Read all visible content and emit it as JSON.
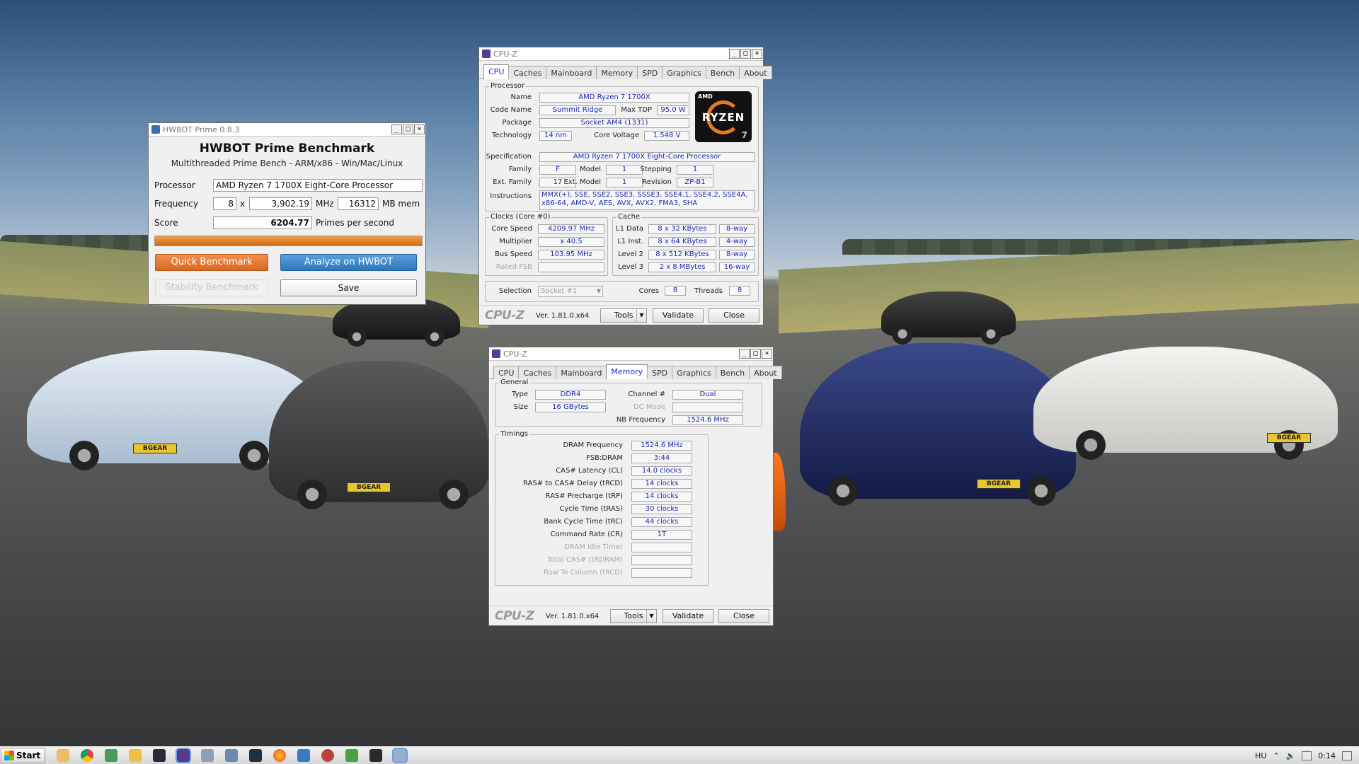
{
  "colors": {
    "cpuz_value_text": "#1c2ab0",
    "cpuz_active_tab": "#1030d0",
    "hwbot_orange": "#e07830",
    "hwbot_blue": "#3a86c8",
    "hwbot_progress": "#e07a1a"
  },
  "background": {
    "plate_text": "BGEAR"
  },
  "hwbot": {
    "title": "HWBOT Prime 0.8.3",
    "heading": "HWBOT Prime Benchmark",
    "subheading": "Multithreaded Prime Bench - ARM/x86 - Win/Mac/Linux",
    "processor_label": "Processor",
    "processor_value": "AMD Ryzen 7 1700X Eight-Core Processor",
    "frequency_label": "Frequency",
    "freq_threads": "8",
    "freq_x": "x",
    "freq_mhz": "3,902.19",
    "freq_mhz_unit": "MHz",
    "mem_value": "16312",
    "mem_unit": "MB mem",
    "score_label": "Score",
    "score_value": "6204.77",
    "score_unit": "Primes per second",
    "progress": 1.0,
    "quick_btn": "Quick Benchmark",
    "analyze_btn": "Analyze on HWBOT",
    "stability_btn": "Stability Benchmark",
    "save_btn": "Save"
  },
  "cpuz1": {
    "title": "CPU-Z",
    "tabs": [
      "CPU",
      "Caches",
      "Mainboard",
      "Memory",
      "SPD",
      "Graphics",
      "Bench",
      "About"
    ],
    "active_tab": "CPU",
    "processor_group": "Processor",
    "name_label": "Name",
    "name_value": "AMD Ryzen 7 1700X",
    "codename_label": "Code Name",
    "codename_value": "Summit Ridge",
    "maxtdp_label": "Max TDP",
    "maxtdp_value": "95.0 W",
    "package_label": "Package",
    "package_value": "Socket AM4 (1331)",
    "technology_label": "Technology",
    "technology_value": "14 nm",
    "corevoltage_label": "Core Voltage",
    "corevoltage_value": "1.548 V",
    "logo_brand": "AMD",
    "logo_text": "RYZEN",
    "logo_num": "7",
    "spec_label": "Specification",
    "spec_value": "AMD Ryzen 7 1700X Eight-Core Processor",
    "family_label": "Family",
    "family_value": "F",
    "model_label": "Model",
    "model_value": "1",
    "stepping_label": "Stepping",
    "stepping_value": "1",
    "extfamily_label": "Ext. Family",
    "extfamily_value": "17",
    "extmodel_label": "Ext. Model",
    "extmodel_value": "1",
    "revision_label": "Revision",
    "revision_value": "ZP-B1",
    "instructions_label": "Instructions",
    "instructions_line1": "MMX(+), SSE, SSE2, SSE3, SSSE3, SSE4.1, SSE4.2, SSE4A,",
    "instructions_line2": "x86-64, AMD-V, AES, AVX, AVX2, FMA3, SHA",
    "clocks_group": "Clocks (Core #0)",
    "corespeed_label": "Core Speed",
    "corespeed_value": "4209.97 MHz",
    "multiplier_label": "Multiplier",
    "multiplier_value": "x 40.5",
    "busspeed_label": "Bus Speed",
    "busspeed_value": "103.95 MHz",
    "ratedfsb_label": "Rated FSB",
    "ratedfsb_value": "",
    "cache_group": "Cache",
    "l1data_label": "L1 Data",
    "l1data_value": "8 x 32 KBytes",
    "l1data_way": "8-way",
    "l1inst_label": "L1 Inst.",
    "l1inst_value": "8 x 64 KBytes",
    "l1inst_way": "4-way",
    "level2_label": "Level 2",
    "level2_value": "8 x 512 KBytes",
    "level2_way": "8-way",
    "level3_label": "Level 3",
    "level3_value": "2 x 8 MBytes",
    "level3_way": "16-way",
    "selection_label": "Selection",
    "selection_value": "Socket #1",
    "cores_label": "Cores",
    "cores_value": "8",
    "threads_label": "Threads",
    "threads_value": "8",
    "footer_logo": "CPU-Z",
    "version": "Ver. 1.81.0.x64",
    "tools_btn": "Tools",
    "validate_btn": "Validate",
    "close_btn": "Close"
  },
  "cpuz2": {
    "title": "CPU-Z",
    "tabs": [
      "CPU",
      "Caches",
      "Mainboard",
      "Memory",
      "SPD",
      "Graphics",
      "Bench",
      "About"
    ],
    "active_tab": "Memory",
    "general_group": "General",
    "type_label": "Type",
    "type_value": "DDR4",
    "size_label": "Size",
    "size_value": "16 GBytes",
    "channel_label": "Channel #",
    "channel_value": "Dual",
    "dcmode_label": "DC Mode",
    "dcmode_value": "",
    "nbfreq_label": "NB Frequency",
    "nbfreq_value": "1524.6 MHz",
    "timings_group": "Timings",
    "timings": [
      {
        "label": "DRAM Frequency",
        "value": "1524.6 MHz",
        "dim": false
      },
      {
        "label": "FSB:DRAM",
        "value": "3:44",
        "dim": false
      },
      {
        "label": "CAS# Latency (CL)",
        "value": "14.0 clocks",
        "dim": false
      },
      {
        "label": "RAS# to CAS# Delay (tRCD)",
        "value": "14 clocks",
        "dim": false
      },
      {
        "label": "RAS# Precharge (tRP)",
        "value": "14 clocks",
        "dim": false
      },
      {
        "label": "Cycle Time (tRAS)",
        "value": "30 clocks",
        "dim": false
      },
      {
        "label": "Bank Cycle Time (tRC)",
        "value": "44 clocks",
        "dim": false
      },
      {
        "label": "Command Rate (CR)",
        "value": "1T",
        "dim": false
      },
      {
        "label": "DRAM Idle Timer",
        "value": "",
        "dim": true
      },
      {
        "label": "Total CAS# (tRDRAM)",
        "value": "",
        "dim": true
      },
      {
        "label": "Row To Column (tRCD)",
        "value": "",
        "dim": true
      }
    ],
    "footer_logo": "CPU-Z",
    "version": "Ver. 1.81.0.x64",
    "tools_btn": "Tools",
    "validate_btn": "Validate",
    "close_btn": "Close"
  },
  "taskbar": {
    "start_label": "Start",
    "language": "HU",
    "clock": "0:14"
  }
}
